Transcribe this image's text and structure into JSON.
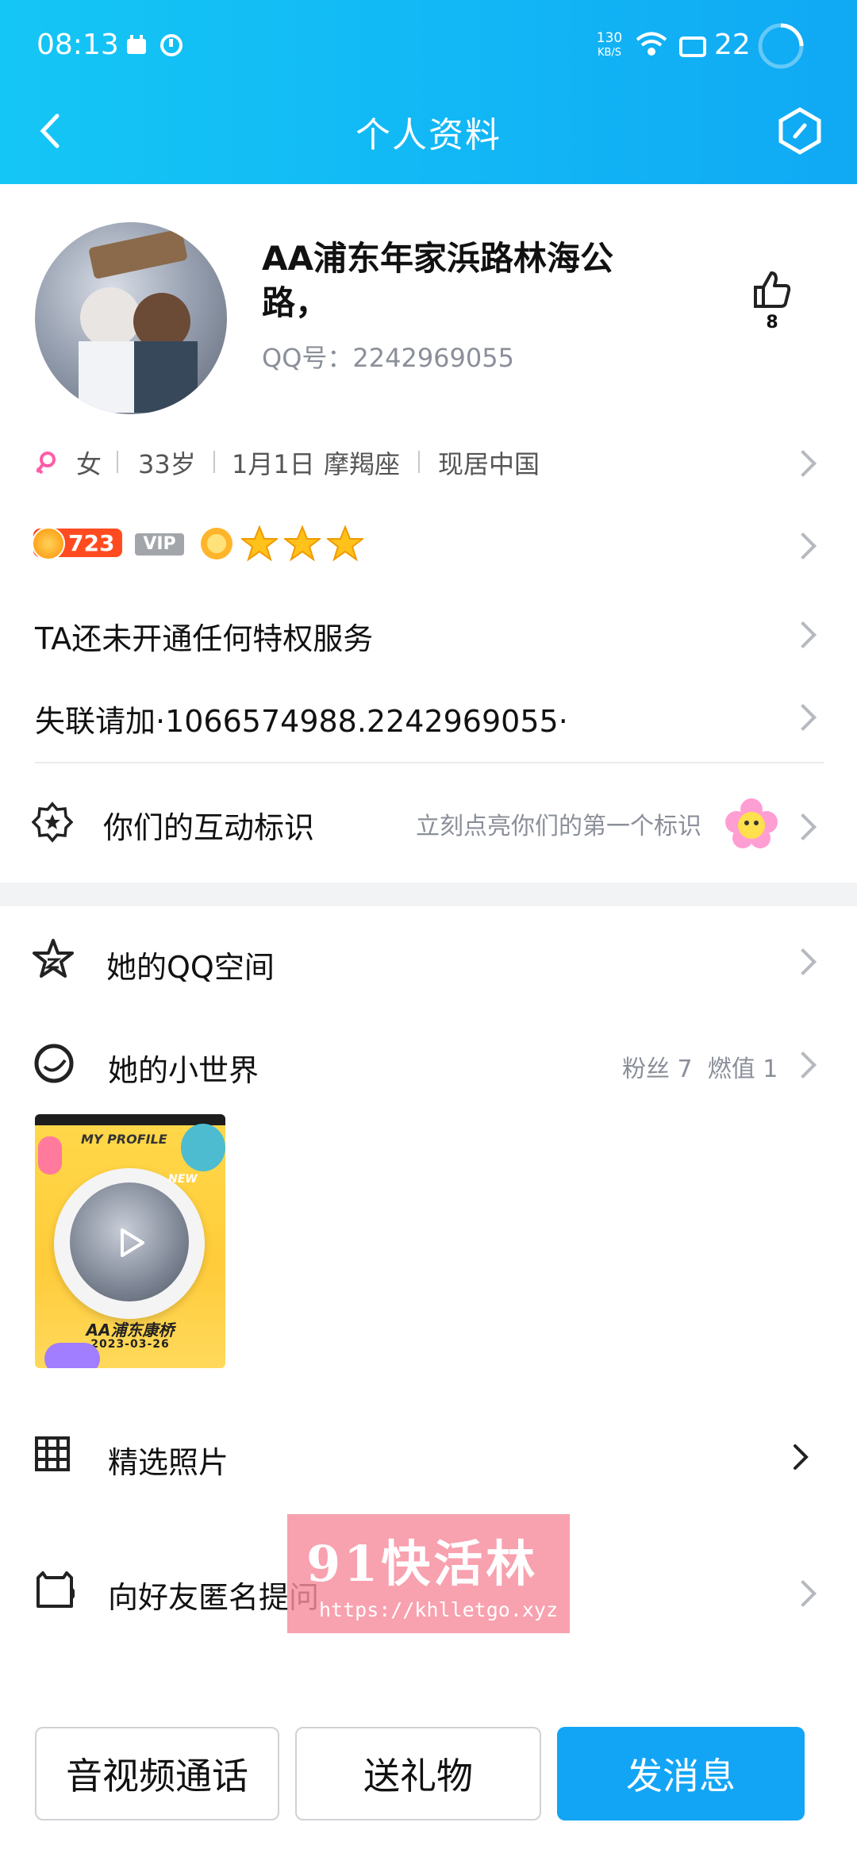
{
  "status_bar": {
    "time": "08:13",
    "net_speed_top": "130",
    "net_speed_unit": "KB/S",
    "battery": "22"
  },
  "header": {
    "title": "个人资料"
  },
  "profile": {
    "name": "AA浦东年家浜路林海公路，",
    "qq_label": "QQ号：2242969055",
    "like_count": "8"
  },
  "info": {
    "gender": "女",
    "age": "33岁",
    "birthday": "1月1日",
    "zodiac": "摩羯座",
    "location": "现居中国"
  },
  "level": {
    "number": "723",
    "vip_label": "VIP"
  },
  "privilege_text": "TA还未开通任何特权服务",
  "lost_contact_text": "失联请加·1066574988.2242969055·",
  "interaction": {
    "label": "你们的互动标识",
    "hint": "立刻点亮你们的第一个标识"
  },
  "qzone_label": "她的QQ空间",
  "world": {
    "label": "她的小世界",
    "stats": "粉丝 7  燃值 1",
    "thumb_top": "MY PROFILE",
    "thumb_new": "NEW",
    "thumb_name": "AA浦东康桥",
    "thumb_date": "2023-03-26"
  },
  "photos_label": "精选照片",
  "anon_label": "向好友匿名提问",
  "watermark": {
    "brand": "91快活林",
    "url": "https://khlletgo.xyz"
  },
  "buttons": {
    "call": "音视频通话",
    "gift": "送礼物",
    "message": "发消息"
  },
  "colors": {
    "header_start": "#14c6f5",
    "header_end": "#10a9f4",
    "primary_button": "#12a5f6"
  }
}
